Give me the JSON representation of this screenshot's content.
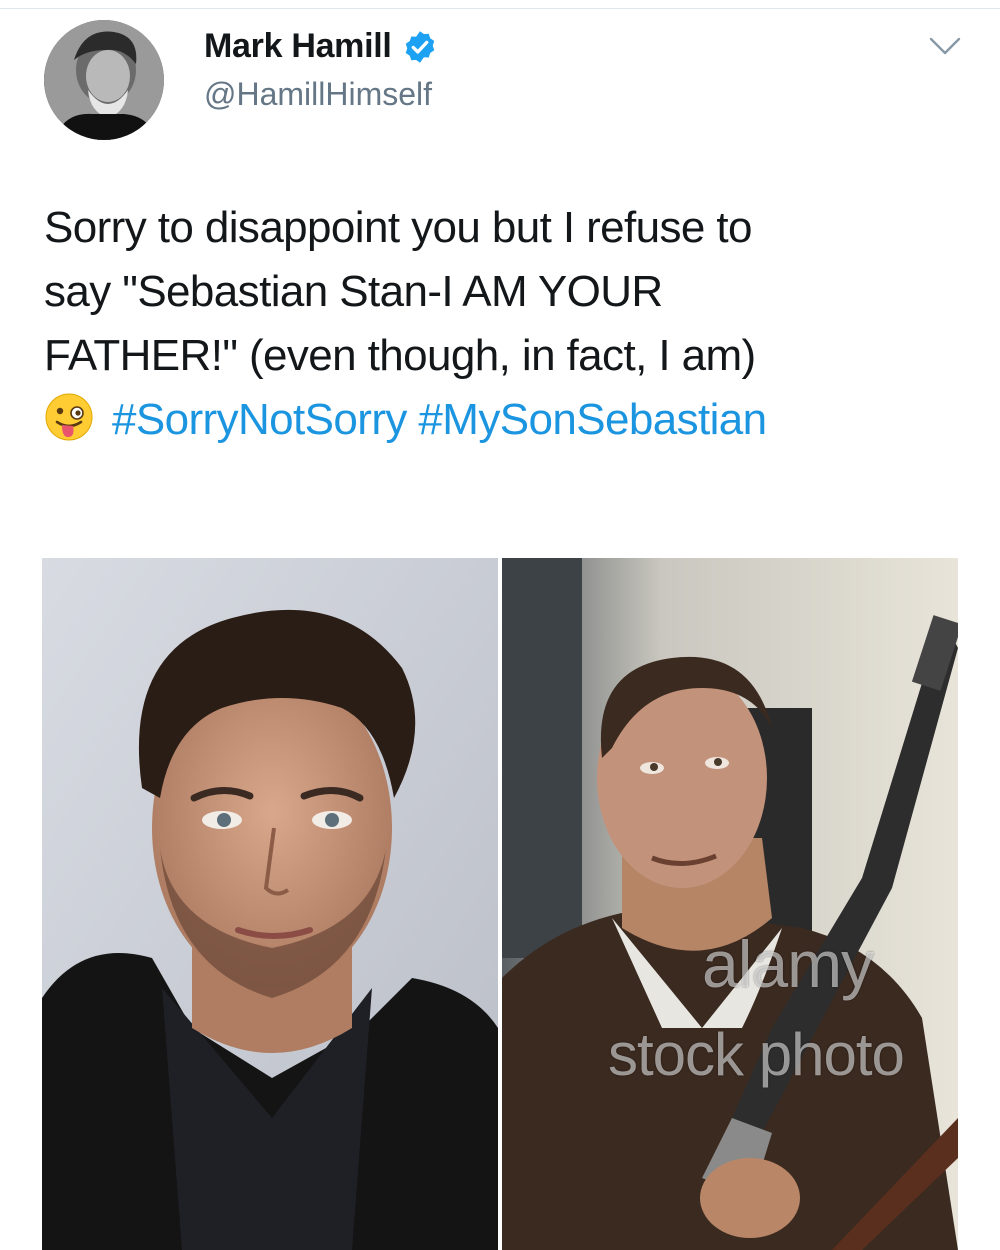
{
  "tweet": {
    "author": {
      "display_name": "Mark Hamill",
      "handle": "@HamillHimself",
      "verified": true
    },
    "text_lines": [
      "Sorry to disappoint you but I refuse to",
      "say \"Sebastian Stan-I AM YOUR",
      "FATHER!\" (even though, in fact, I am)"
    ],
    "hashtags": [
      "#SorryNotSorry",
      "#MySonSebastian"
    ],
    "emoji": "winking-face-with-tongue-icon",
    "media": {
      "watermark_brand": "alamy",
      "watermark_sub": "stock photo"
    }
  },
  "colors": {
    "text": "#14171a",
    "secondary": "#657786",
    "link": "#1b95e0",
    "verified": "#1da1f2"
  }
}
